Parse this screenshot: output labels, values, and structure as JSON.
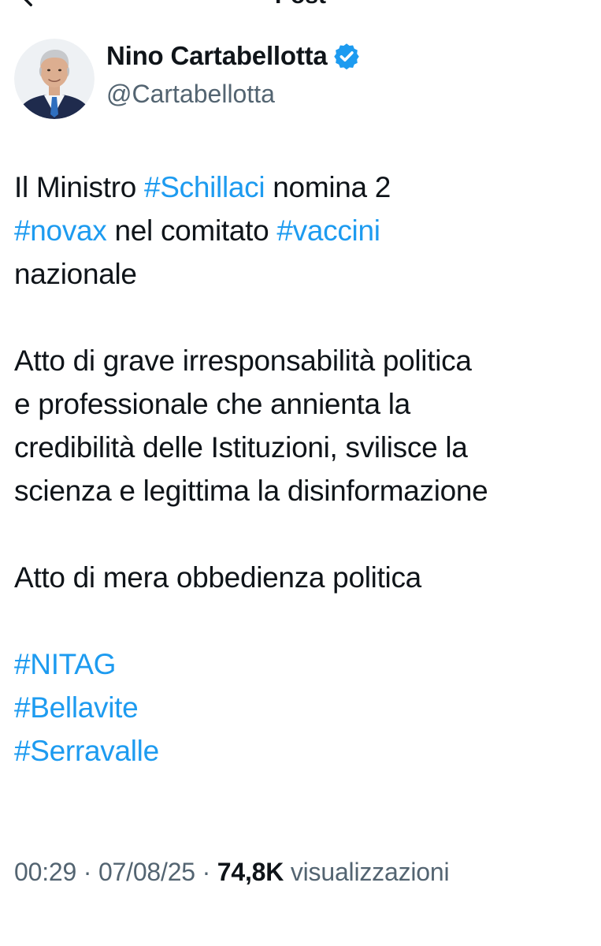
{
  "header": {
    "title": "Post",
    "back_icon": "arrow-left-icon"
  },
  "author": {
    "display_name": "Nino Cartabellotta",
    "handle": "@Cartabellotta",
    "verified": true,
    "verified_icon": "verified-badge-icon",
    "verified_color": "#1d9bf0"
  },
  "tweet": {
    "p1": {
      "l1a": "Il Ministro ",
      "l1tag": "#Schillaci",
      "l1b": " nomina 2",
      "l2tag": "#novax",
      "l2b": " nel comitato ",
      "l2tag2": "#vaccini",
      "l3": "nazionale"
    },
    "p2": {
      "l1": "Atto di grave irresponsabilità politica",
      "l2": "e professionale che annienta la",
      "l3": "credibilità delle Istituzioni, svilisce la",
      "l4": "scienza e legittima la disinformazione"
    },
    "p3": {
      "l1": "Atto di mera obbedienza politica"
    },
    "p4": {
      "tag1": "#NITAG",
      "tag2": "#Bellavite",
      "tag3": "#Serravalle"
    },
    "hashtag_color": "#1d9bf0"
  },
  "meta": {
    "time": "00:29",
    "separator": " · ",
    "date": "07/08/25",
    "views_count": "74,8K",
    "views_label": " visualizzazioni"
  }
}
